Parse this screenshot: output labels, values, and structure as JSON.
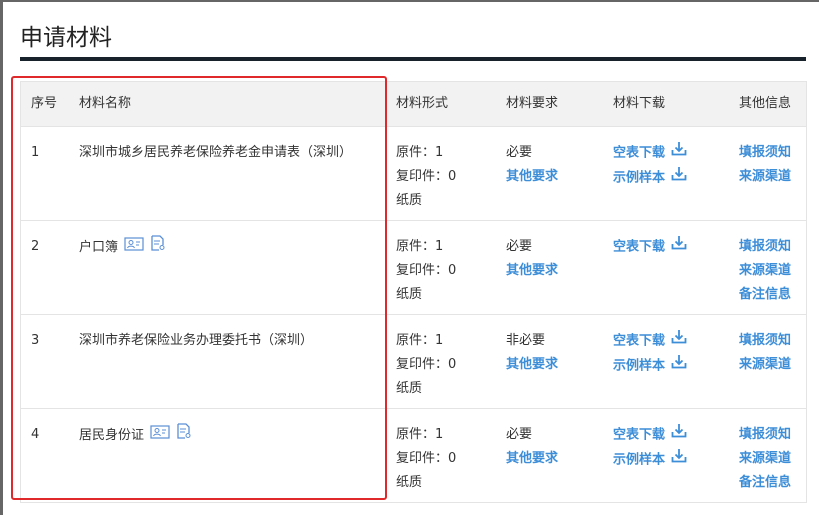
{
  "title": "申请材料",
  "headers": [
    "序号",
    "材料名称",
    "材料形式",
    "材料要求",
    "材料下载",
    "其他信息"
  ],
  "rows": [
    {
      "no": "1",
      "name": "深圳市城乡居民养老保险养老金申请表（深圳）",
      "icons": [],
      "form": [
        "原件：1",
        "复印件：0",
        "纸质"
      ],
      "req": "必要",
      "req_link": "其他要求",
      "downloads": [
        "空表下载",
        "示例样本"
      ],
      "other": [
        "填报须知",
        "来源渠道"
      ]
    },
    {
      "no": "2",
      "name": "户口簿",
      "icons": [
        "id-card-icon",
        "document-search-icon"
      ],
      "form": [
        "原件：1",
        "复印件：0",
        "纸质"
      ],
      "req": "必要",
      "req_link": "其他要求",
      "downloads": [
        "空表下载"
      ],
      "other": [
        "填报须知",
        "来源渠道",
        "备注信息"
      ]
    },
    {
      "no": "3",
      "name": "深圳市养老保险业务办理委托书（深圳）",
      "icons": [],
      "form": [
        "原件：1",
        "复印件：0",
        "纸质"
      ],
      "req": "非必要",
      "req_link": "其他要求",
      "downloads": [
        "空表下载",
        "示例样本"
      ],
      "other": [
        "填报须知",
        "来源渠道"
      ]
    },
    {
      "no": "4",
      "name": "居民身份证",
      "icons": [
        "id-card-icon",
        "document-search-icon"
      ],
      "form": [
        "原件：1",
        "复印件：0",
        "纸质"
      ],
      "req": "必要",
      "req_link": "其他要求",
      "downloads": [
        "空表下载",
        "示例样本"
      ],
      "other": [
        "填报须知",
        "来源渠道",
        "备注信息"
      ]
    }
  ],
  "colors": {
    "link": "#3d8ed8",
    "highlight": "#e0292a"
  }
}
